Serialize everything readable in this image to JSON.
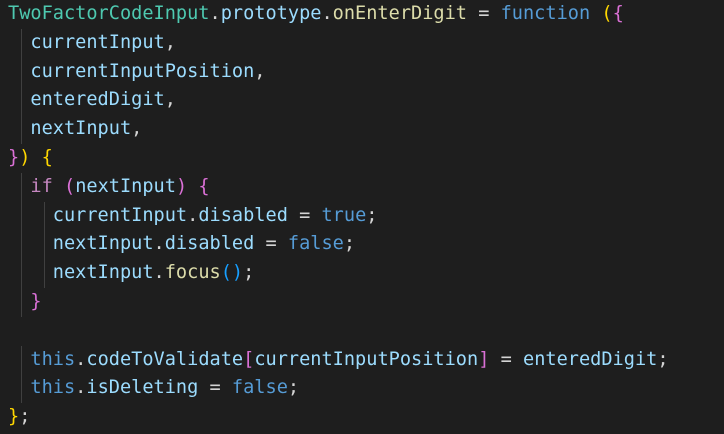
{
  "lines": [
    [
      {
        "t": "TwoFactorCodeInput",
        "c": "t-class"
      },
      {
        "t": ".",
        "c": "t-punct"
      },
      {
        "t": "prototype",
        "c": "t-var"
      },
      {
        "t": ".",
        "c": "t-punct"
      },
      {
        "t": "onEnterDigit",
        "c": "t-fn"
      },
      {
        "t": " = ",
        "c": "t-punct"
      },
      {
        "t": "function",
        "c": "t-keyword"
      },
      {
        "t": " ",
        "c": "t-punct"
      },
      {
        "t": "(",
        "c": "t-bracket-gold"
      },
      {
        "t": "{",
        "c": "t-bracket-pink"
      }
    ],
    [
      {
        "t": "  ",
        "c": "t-punct"
      },
      {
        "t": "currentInput",
        "c": "t-var"
      },
      {
        "t": ",",
        "c": "t-punct"
      }
    ],
    [
      {
        "t": "  ",
        "c": "t-punct"
      },
      {
        "t": "currentInputPosition",
        "c": "t-var"
      },
      {
        "t": ",",
        "c": "t-punct"
      }
    ],
    [
      {
        "t": "  ",
        "c": "t-punct"
      },
      {
        "t": "enteredDigit",
        "c": "t-var"
      },
      {
        "t": ",",
        "c": "t-punct"
      }
    ],
    [
      {
        "t": "  ",
        "c": "t-punct"
      },
      {
        "t": "nextInput",
        "c": "t-var"
      },
      {
        "t": ",",
        "c": "t-punct"
      }
    ],
    [
      {
        "t": "}",
        "c": "t-bracket-pink"
      },
      {
        "t": ")",
        "c": "t-bracket-gold"
      },
      {
        "t": " ",
        "c": "t-punct"
      },
      {
        "t": "{",
        "c": "t-bracket-gold"
      }
    ],
    [
      {
        "t": "  ",
        "c": "t-punct"
      },
      {
        "t": "if",
        "c": "t-control"
      },
      {
        "t": " ",
        "c": "t-punct"
      },
      {
        "t": "(",
        "c": "t-bracket-pink"
      },
      {
        "t": "nextInput",
        "c": "t-var"
      },
      {
        "t": ")",
        "c": "t-bracket-pink"
      },
      {
        "t": " ",
        "c": "t-punct"
      },
      {
        "t": "{",
        "c": "t-bracket-pink"
      }
    ],
    [
      {
        "t": "    ",
        "c": "t-punct"
      },
      {
        "t": "currentInput",
        "c": "t-var"
      },
      {
        "t": ".",
        "c": "t-punct"
      },
      {
        "t": "disabled",
        "c": "t-var"
      },
      {
        "t": " = ",
        "c": "t-punct"
      },
      {
        "t": "true",
        "c": "t-literal"
      },
      {
        "t": ";",
        "c": "t-punct"
      }
    ],
    [
      {
        "t": "    ",
        "c": "t-punct"
      },
      {
        "t": "nextInput",
        "c": "t-var"
      },
      {
        "t": ".",
        "c": "t-punct"
      },
      {
        "t": "disabled",
        "c": "t-var"
      },
      {
        "t": " = ",
        "c": "t-punct"
      },
      {
        "t": "false",
        "c": "t-literal"
      },
      {
        "t": ";",
        "c": "t-punct"
      }
    ],
    [
      {
        "t": "    ",
        "c": "t-punct"
      },
      {
        "t": "nextInput",
        "c": "t-var"
      },
      {
        "t": ".",
        "c": "t-punct"
      },
      {
        "t": "focus",
        "c": "t-fn"
      },
      {
        "t": "()",
        "c": "t-bracket-blue"
      },
      {
        "t": ";",
        "c": "t-punct"
      }
    ],
    [
      {
        "t": "  ",
        "c": "t-punct"
      },
      {
        "t": "}",
        "c": "t-bracket-pink"
      }
    ],
    [],
    [
      {
        "t": "  ",
        "c": "t-punct"
      },
      {
        "t": "this",
        "c": "t-keyword"
      },
      {
        "t": ".",
        "c": "t-punct"
      },
      {
        "t": "codeToValidate",
        "c": "t-var"
      },
      {
        "t": "[",
        "c": "t-bracket-pink"
      },
      {
        "t": "currentInputPosition",
        "c": "t-var"
      },
      {
        "t": "]",
        "c": "t-bracket-pink"
      },
      {
        "t": " = ",
        "c": "t-punct"
      },
      {
        "t": "enteredDigit",
        "c": "t-var"
      },
      {
        "t": ";",
        "c": "t-punct"
      }
    ],
    [
      {
        "t": "  ",
        "c": "t-punct"
      },
      {
        "t": "this",
        "c": "t-keyword"
      },
      {
        "t": ".",
        "c": "t-punct"
      },
      {
        "t": "isDeleting",
        "c": "t-var"
      },
      {
        "t": " = ",
        "c": "t-punct"
      },
      {
        "t": "false",
        "c": "t-literal"
      },
      {
        "t": ";",
        "c": "t-punct"
      }
    ],
    [
      {
        "t": "}",
        "c": "t-bracket-gold"
      },
      {
        "t": ";",
        "c": "t-punct"
      }
    ]
  ],
  "colors": {
    "background": "#1e1e1e",
    "class": "#4ec9b0",
    "function": "#dcdcaa",
    "keyword": "#569cd6",
    "control": "#c586c0",
    "variable": "#9cdcfe",
    "bracket_gold": "#ffd700",
    "bracket_pink": "#da70d6",
    "bracket_blue": "#179fff"
  }
}
